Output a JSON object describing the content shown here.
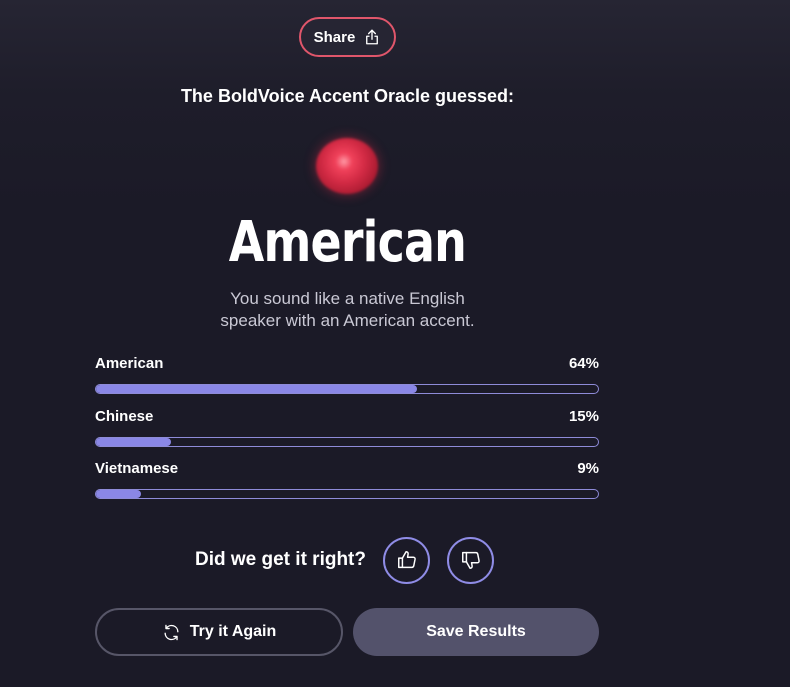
{
  "share": {
    "label": "Share",
    "icon": "share-icon"
  },
  "result": {
    "heading": "The BoldVoice Accent Oracle guessed:",
    "accent": "American",
    "description_line1": "You sound like a native English",
    "description_line2": "speaker with an American accent."
  },
  "breakdown": [
    {
      "label": "American",
      "percent_text": "64%",
      "value": 64
    },
    {
      "label": "Chinese",
      "percent_text": "15%",
      "value": 15
    },
    {
      "label": "Vietnamese",
      "percent_text": "9%",
      "value": 9
    }
  ],
  "feedback": {
    "question": "Did we get it right?",
    "thumbs_up_icon": "thumbs-up-icon",
    "thumbs_down_icon": "thumbs-down-icon"
  },
  "actions": {
    "try_again_label": "Try it Again",
    "try_again_icon": "refresh-icon",
    "save_label": "Save Results"
  },
  "colors": {
    "background": "#1b1a27",
    "share_border": "#e0566b",
    "bar_fill": "#8a87e6",
    "bar_border": "#8e8bd8",
    "save_button": "#53526b",
    "orb": "#d22a44"
  }
}
